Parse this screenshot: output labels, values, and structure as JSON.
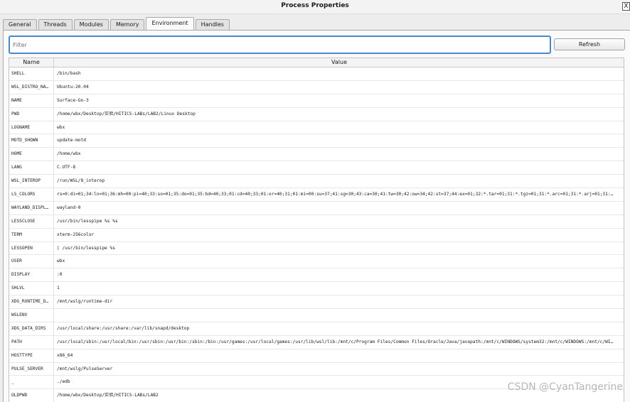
{
  "window": {
    "title": "Process Properties",
    "close_label": "X"
  },
  "tabs": [
    {
      "label": "General",
      "active": false
    },
    {
      "label": "Threads",
      "active": false
    },
    {
      "label": "Modules",
      "active": false
    },
    {
      "label": "Memory",
      "active": false
    },
    {
      "label": "Environment",
      "active": true
    },
    {
      "label": "Handles",
      "active": false
    }
  ],
  "filter": {
    "placeholder": "Filter",
    "value": ""
  },
  "toolbar": {
    "refresh_label": "Refresh"
  },
  "table": {
    "columns": [
      "Name",
      "Value"
    ],
    "rows": [
      {
        "name": "SHELL",
        "value": "/bin/bash"
      },
      {
        "name": "WSL_DISTRO_NA…",
        "value": "Ubuntu-20.04"
      },
      {
        "name": "NAME",
        "value": "Surface-Go-3"
      },
      {
        "name": "PWD",
        "value": "/home/wbx/Desktop/实验/HITICS-LABs/LAB2/Linux Desktop"
      },
      {
        "name": "LOGNAME",
        "value": "wbx"
      },
      {
        "name": "MOTD_SHOWN",
        "value": "update-motd"
      },
      {
        "name": "HOME",
        "value": "/home/wbx"
      },
      {
        "name": "LANG",
        "value": "C.UTF-8"
      },
      {
        "name": "WSL_INTEROP",
        "value": "/run/WSL/8_interop"
      },
      {
        "name": "LS_COLORS",
        "value": "rs=0:di=01;34:ln=01;36:mh=00:pi=40;33:so=01;35:do=01;35:bd=40;33;01:cd=40;33;01:or=40;31;01:mi=00:su=37;41:sg=30;43:ca=30;41:tw=30;42:ow=34;42:st=37;44:ex=01;32:*.tar=01;31:*.tgz=01;31:*.arc=01;31:*.arj=01;31:…"
      },
      {
        "name": "WAYLAND_DISPL…",
        "value": "wayland-0"
      },
      {
        "name": "LESSCLOSE",
        "value": "/usr/bin/lesspipe %s %s"
      },
      {
        "name": "TERM",
        "value": "xterm-256color"
      },
      {
        "name": "LESSOPEN",
        "value": "| /usr/bin/lesspipe %s"
      },
      {
        "name": "USER",
        "value": "wbx"
      },
      {
        "name": "DISPLAY",
        "value": ":0"
      },
      {
        "name": "SHLVL",
        "value": "1"
      },
      {
        "name": "XDG_RUNTIME_D…",
        "value": "/mnt/wslg/runtime-dir"
      },
      {
        "name": "WSLENV",
        "value": ""
      },
      {
        "name": "XDG_DATA_DIRS",
        "value": "/usr/local/share:/usr/share:/var/lib/snapd/desktop"
      },
      {
        "name": "PATH",
        "value": "/usr/local/sbin:/usr/local/bin:/usr/sbin:/usr/bin:/sbin:/bin:/usr/games:/usr/local/games:/usr/lib/wsl/lib:/mnt/c/Program Files/Common Files/Oracle/Java/javapath:/mnt/c/WINDOWS/system32:/mnt/c/WINDOWS:/mnt/c/WI…"
      },
      {
        "name": "HOSTTYPE",
        "value": "x86_64"
      },
      {
        "name": "PULSE_SERVER",
        "value": "/mnt/wslg/PulseServer"
      },
      {
        "name": "_",
        "value": "./edb"
      },
      {
        "name": "OLDPWD",
        "value": "/home/wbx/Desktop/实验/HITICS-LABs/LAB2"
      }
    ]
  },
  "watermark": "CSDN @CyanTangerine",
  "colors": {
    "focus_border": "#4c88c8",
    "window_bg": "#ededed"
  }
}
